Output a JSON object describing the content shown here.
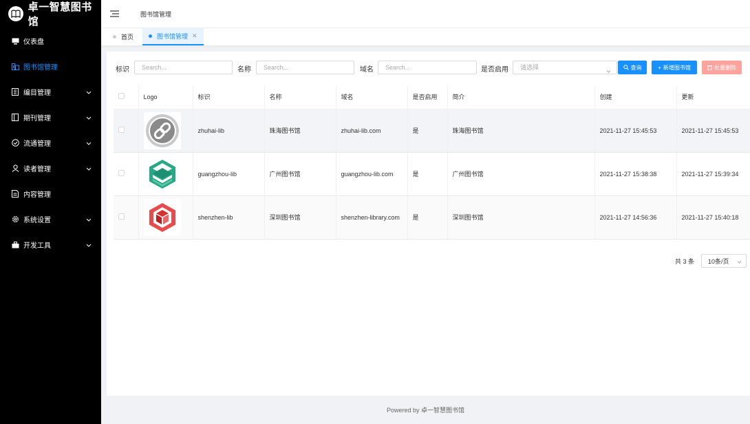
{
  "brand": {
    "title": "卓一智慧图书馆"
  },
  "sidebar": {
    "items": [
      {
        "label": "仪表盘",
        "icon": "monitor-icon",
        "expandable": false,
        "active": false
      },
      {
        "label": "图书馆管理",
        "icon": "library-icon",
        "expandable": false,
        "active": true
      },
      {
        "label": "编目管理",
        "icon": "catalog-icon",
        "expandable": true,
        "active": false
      },
      {
        "label": "期刊管理",
        "icon": "journal-icon",
        "expandable": true,
        "active": false
      },
      {
        "label": "流通管理",
        "icon": "check-circle-icon",
        "expandable": true,
        "active": false
      },
      {
        "label": "读者管理",
        "icon": "user-icon",
        "expandable": true,
        "active": false
      },
      {
        "label": "内容管理",
        "icon": "document-icon",
        "expandable": false,
        "active": false
      },
      {
        "label": "系统设置",
        "icon": "gear-icon",
        "expandable": true,
        "active": false
      },
      {
        "label": "开发工具",
        "icon": "toolbox-icon",
        "expandable": true,
        "active": false
      }
    ]
  },
  "header": {
    "breadcrumb": "图书馆管理"
  },
  "tabs": [
    {
      "label": "首页",
      "active": false,
      "closable": false
    },
    {
      "label": "图书馆管理",
      "active": true,
      "closable": true
    }
  ],
  "filters": {
    "id_label": "标识",
    "id_placeholder": "Search...",
    "name_label": "名称",
    "name_placeholder": "Search...",
    "domain_label": "域名",
    "domain_placeholder": "Search...",
    "enabled_label": "是否启用",
    "enabled_placeholder": "请选择",
    "query_label": "查询",
    "add_label": "新增图书馆",
    "batch_delete_label": "批量删除"
  },
  "table": {
    "columns": [
      "Logo",
      "标识",
      "名称",
      "域名",
      "是否启用",
      "简介",
      "创建",
      "更新"
    ],
    "rows": [
      {
        "logo": "chain-logo",
        "id": "zhuhai-lib",
        "name": "珠海图书馆",
        "domain": "zhuhai-lib.com",
        "enabled": "是",
        "intro": "珠海图书馆",
        "created": "2021-11-27 15:45:53",
        "updated": "2021-11-27 15:45:53"
      },
      {
        "logo": "layers-logo",
        "id": "guangzhou-lib",
        "name": "广州图书馆",
        "domain": "guangzhou-lib.com",
        "enabled": "是",
        "intro": "广州图书馆",
        "created": "2021-11-27 15:38:38",
        "updated": "2021-11-27 15:39:34"
      },
      {
        "logo": "cube-logo",
        "id": "shenzhen-lib",
        "name": "深圳图书馆",
        "domain": "shenzhen-library.com",
        "enabled": "是",
        "intro": "深圳图书馆",
        "created": "2021-11-27 14:56:36",
        "updated": "2021-11-27 15:40:18"
      }
    ]
  },
  "pagination": {
    "total": "共 3 条",
    "page_size": "10条/页"
  },
  "footer": {
    "text": "Powered by 卓一智慧图书馆"
  },
  "colors": {
    "sidebar_bg": "#000000",
    "primary": "#1890ff",
    "danger_light": "#ffa39e",
    "page_bg": "#f0f2f5"
  }
}
